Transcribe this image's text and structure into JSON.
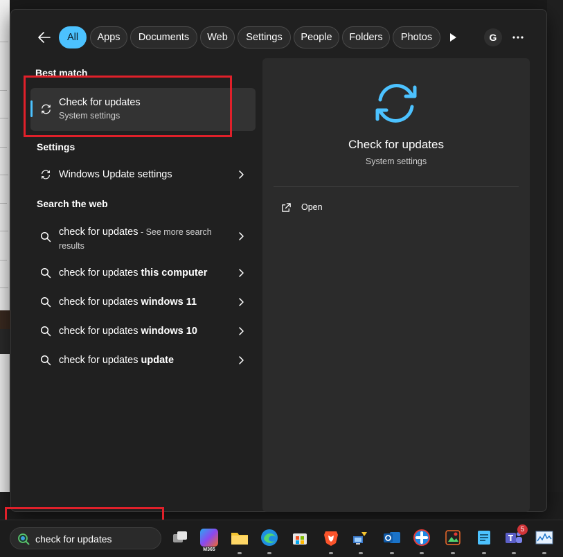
{
  "filters": {
    "items": [
      "All",
      "Apps",
      "Documents",
      "Web",
      "Settings",
      "People",
      "Folders",
      "Photos"
    ],
    "active": "All"
  },
  "account": {
    "initial": "G"
  },
  "sections": {
    "best_match": "Best match",
    "settings": "Settings",
    "search_web": "Search the web"
  },
  "best_match": {
    "title": "Check for updates",
    "subtitle": "System settings",
    "icon": "sync-icon"
  },
  "settings_results": [
    {
      "label": "Windows Update settings",
      "icon": "sync-icon"
    }
  ],
  "web_results": [
    {
      "query": "check for updates",
      "suffix": " - See more search results",
      "bold": ""
    },
    {
      "query": "check for updates ",
      "bold": "this computer"
    },
    {
      "query": "check for updates ",
      "bold": "windows 11"
    },
    {
      "query": "check for updates ",
      "bold": "windows 10"
    },
    {
      "query": "check for updates ",
      "bold": "update"
    }
  ],
  "preview": {
    "title": "Check for updates",
    "subtitle": "System settings",
    "action": "Open"
  },
  "taskbar": {
    "search_value": "check for updates",
    "m365_label": "M365",
    "teams_badge": "5"
  },
  "colors": {
    "accent": "#4cc2ff",
    "highlight": "#e0202a",
    "panel": "#202020",
    "preview": "#2b2b2b"
  }
}
